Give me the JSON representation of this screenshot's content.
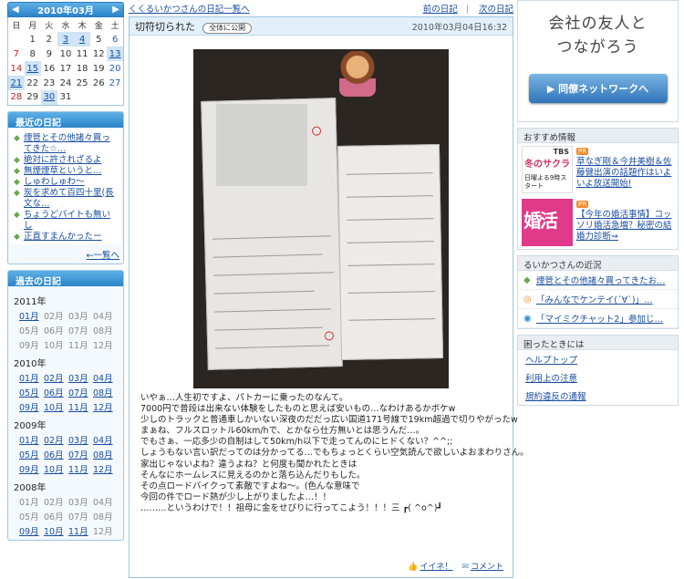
{
  "calendar": {
    "title": "2010年03月",
    "prev_icon": "arrow-left-icon",
    "next_icon": "arrow-right-icon",
    "dow": [
      "日",
      "月",
      "火",
      "水",
      "木",
      "金",
      "土"
    ],
    "weeks": [
      [
        "",
        "1",
        "2",
        "3",
        "4",
        "5",
        "6"
      ],
      [
        "7",
        "8",
        "9",
        "10",
        "11",
        "12",
        "13"
      ],
      [
        "14",
        "15",
        "16",
        "17",
        "18",
        "19",
        "20"
      ],
      [
        "21",
        "22",
        "23",
        "24",
        "25",
        "26",
        "27"
      ],
      [
        "28",
        "29",
        "30",
        "31",
        "",
        "",
        ""
      ]
    ],
    "linked_days": [
      "3",
      "4",
      "13",
      "15",
      "21",
      "30"
    ]
  },
  "recent": {
    "title": "最近の日記",
    "items": [
      "煙管とその他諸々買ってきた☆…",
      "絶対に許されざるよ",
      "無煙煙草というと…",
      "しゅわしゅわ〜",
      "炭を求めて百四十里(長文な…",
      "ちょうどバイトも無いし",
      "正直すまんかったー"
    ],
    "more": "←一覧へ"
  },
  "past": {
    "title": "過去の日記",
    "years": [
      {
        "year": "2011年",
        "months": [
          "01月",
          "02月",
          "03月",
          "04月",
          "05月",
          "06月",
          "07月",
          "08月",
          "09月",
          "10月",
          "11月",
          "12月"
        ],
        "linked": [
          "01月"
        ]
      },
      {
        "year": "2010年",
        "months": [
          "01月",
          "02月",
          "03月",
          "04月",
          "05月",
          "06月",
          "07月",
          "08月",
          "09月",
          "10月",
          "11月",
          "12月"
        ],
        "linked": [
          "01月",
          "02月",
          "03月",
          "04月",
          "05月",
          "06月",
          "07月",
          "08月",
          "09月",
          "10月",
          "11月",
          "12月"
        ]
      },
      {
        "year": "2009年",
        "months": [
          "01月",
          "02月",
          "03月",
          "04月",
          "05月",
          "06月",
          "07月",
          "08月",
          "09月",
          "10月",
          "11月",
          "12月"
        ],
        "linked": [
          "01月",
          "02月",
          "03月",
          "04月",
          "05月",
          "06月",
          "07月",
          "08月",
          "09月",
          "10月",
          "11月",
          "12月"
        ]
      },
      {
        "year": "2008年",
        "months": [
          "01月",
          "02月",
          "03月",
          "04月",
          "05月",
          "06月",
          "07月",
          "08月",
          "09月",
          "10月",
          "11月",
          "12月"
        ],
        "linked": [
          "09月",
          "10月",
          "11月"
        ]
      }
    ]
  },
  "topnav": {
    "back_link": "くくるいかつさんの日記一覧へ",
    "prev": "前の日記",
    "sep": "|",
    "next": "次の日記"
  },
  "post": {
    "title": "切符切られた",
    "badge": "全体に公開",
    "date": "2010年03月04日16:32",
    "lines": [
      "いやぁ…人生初ですよ、パトカーに乗ったのなんて。",
      "7000円で普段は出来ない体験をしたものと思えば安いもの…なわけあるかボケw",
      "少しのトラックと普通車しかいない深夜のだだっ広い国道171号線で19km超過で切りやがったw",
      "まぁね、フルスロットル60km/hで、とかなら仕方無いとは思うんだ…。",
      "でもさぁ、一応多少の自制はして50km/h以下で走ってんのにヒドくない？^^;;",
      "しょうもない言い訳だってのは分かってる…でもちょっとくらい空気読んで欲しいよおまわりさん。",
      "家出じゃないよね？違うよね？と何度も聞かれたときは",
      "そんなにホームレスに見えるのかと落ち込んだりもした。",
      "その点ロードバイクって素敵ですよね〜。(色んな意味で",
      "今回の件でロード熱が少し上がりましたよ…！！",
      "………というわけで！！祖母に金をせびりに行ってこよう！！！三 ┏( ^o^)┛"
    ],
    "iine": "イイネ！",
    "comment": "コメント"
  },
  "right": {
    "promo_title_1": "会社の友人と",
    "promo_title_2": "つながろう",
    "promo_button": "▶ 同僚ネットワークへ",
    "rec_title": "おすすめ情報",
    "recs": [
      {
        "pr": "PR",
        "text": "草なぎ剛＆今井美樹＆佐藤健出演の話題作はいよいよ放送開始!",
        "img_text_1": "TBS",
        "img_text_2": "冬のサクラ",
        "img_text_3": "日曜よる9時スタート"
      },
      {
        "pr": "PR",
        "text": "【今年の婚活事情】コッソリ婚活急増？秘密の結婚力診断⇒",
        "img_text_1": "婚活"
      }
    ],
    "status_title": "るいかつさんの近況",
    "status": [
      {
        "icon": "pencil-icon",
        "text": "煙管とその他諸々買ってきたお…"
      },
      {
        "icon": "chat-icon",
        "text": "「みんなでケンテイ(´∀`)」…"
      },
      {
        "icon": "voice-icon",
        "text": "「マイミクチャット2」参加じ…"
      }
    ],
    "help_title": "困ったときには",
    "help": [
      "ヘルプトップ",
      "利用上の注意",
      "規約違反の通報"
    ]
  }
}
